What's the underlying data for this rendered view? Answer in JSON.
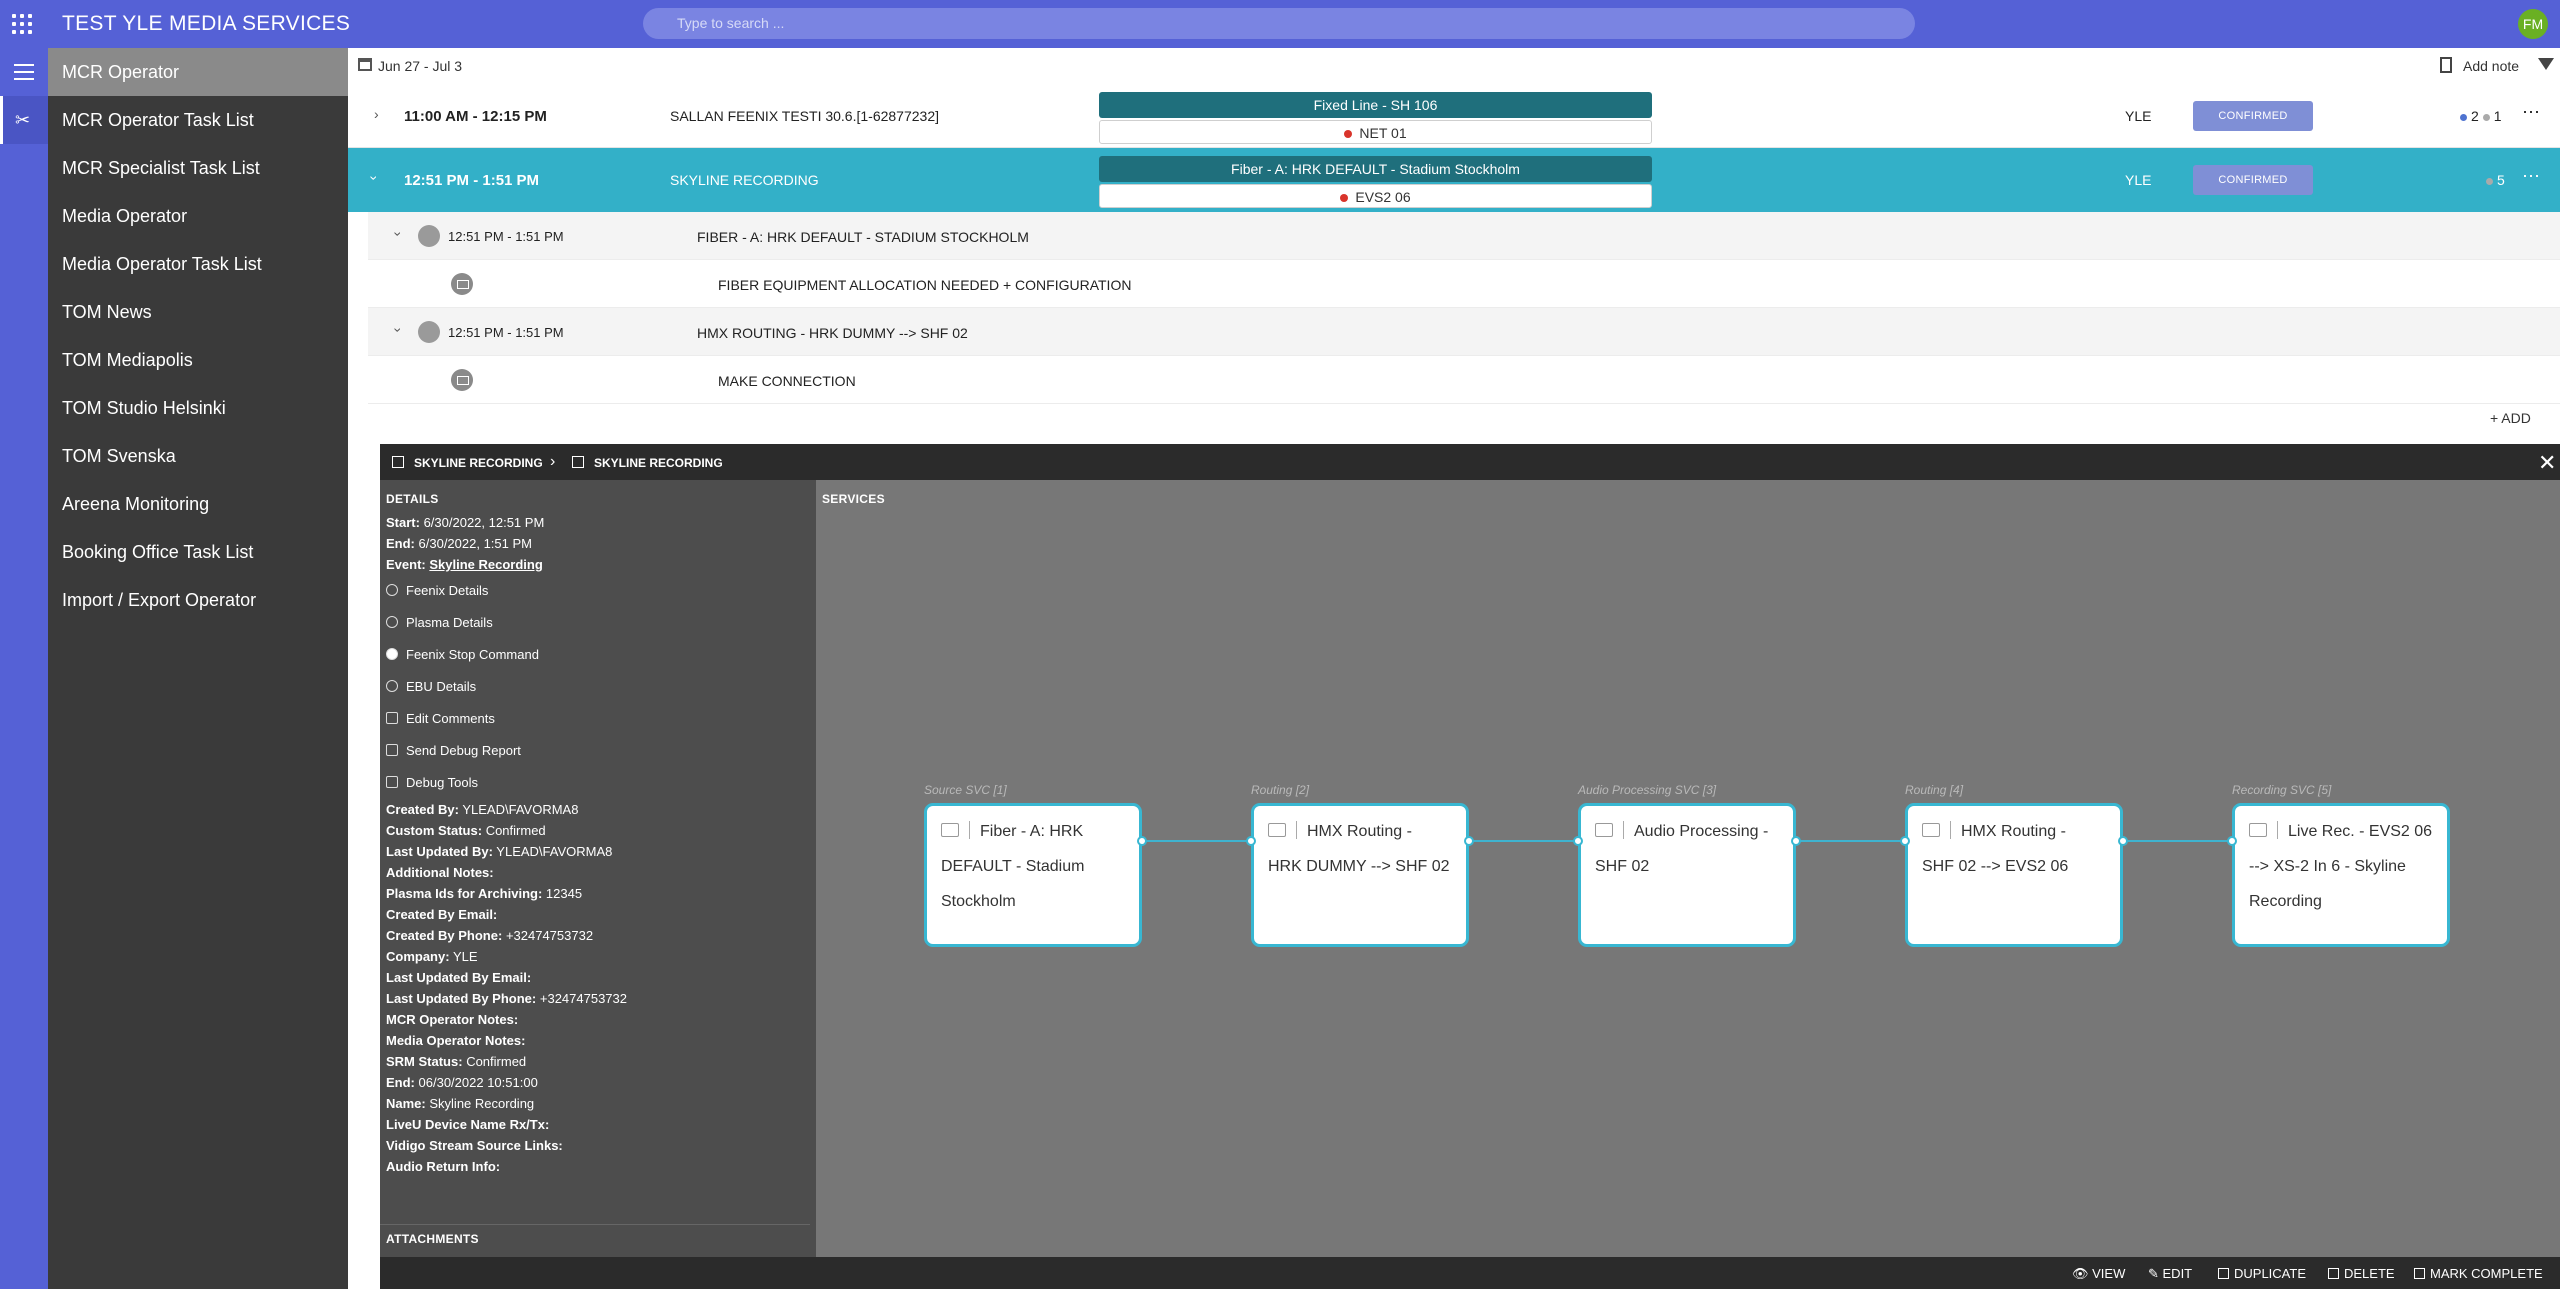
{
  "app": {
    "title": "TEST YLE MEDIA SERVICES",
    "avatar_initials": "FM"
  },
  "search": {
    "placeholder": "Type to search ..."
  },
  "sidebar": {
    "items": [
      {
        "label": "MCR Operator",
        "active": true
      },
      {
        "label": "MCR Operator Task List"
      },
      {
        "label": "MCR Specialist Task List"
      },
      {
        "label": "Media Operator"
      },
      {
        "label": "Media Operator Task List"
      },
      {
        "label": "TOM News"
      },
      {
        "label": "TOM Mediapolis"
      },
      {
        "label": "TOM Studio Helsinki"
      },
      {
        "label": "TOM Svenska"
      },
      {
        "label": "Areena Monitoring"
      },
      {
        "label": "Booking Office Task List"
      },
      {
        "label": "Import / Export Operator"
      }
    ]
  },
  "toolbar": {
    "date_range": "Jun 27 - Jul 3",
    "add_note": "Add note"
  },
  "bookings": [
    {
      "time": "11:00 AM - 12:15 PM",
      "name": "SALLAN FEENIX TESTI 30.6.[1-62877232]",
      "service_top": "Fixed Line - SH 106",
      "service_bottom": "NET 01",
      "company": "YLE",
      "status": "CONFIRMED",
      "count_a": "2",
      "count_b": "1"
    },
    {
      "time": "12:51 PM - 1:51 PM",
      "name": "SKYLINE RECORDING",
      "service_top": "Fiber - A: HRK DEFAULT - Stadium Stockholm",
      "service_bottom": "EVS2 06",
      "company": "YLE",
      "status": "CONFIRMED",
      "count_a": "5"
    }
  ],
  "subrows": [
    {
      "time": "12:51 PM - 1:51 PM",
      "name": "FIBER - A: HRK DEFAULT - STADIUM STOCKHOLM"
    },
    {
      "task": "FIBER EQUIPMENT ALLOCATION NEEDED + CONFIGURATION"
    },
    {
      "time": "12:51 PM - 1:51 PM",
      "name": "HMX ROUTING - HRK DUMMY --> SHF 02"
    },
    {
      "task": "MAKE CONNECTION"
    }
  ],
  "add_label": "ADD",
  "panel": {
    "crumb1": "SKYLINE RECORDING",
    "crumb2": "SKYLINE RECORDING",
    "details_title": "DETAILS",
    "services_title": "SERVICES",
    "attachments_title": "ATTACHMENTS",
    "start_label": "Start:",
    "start_value": "6/30/2022, 12:51 PM",
    "end_label": "End:",
    "end_value": "6/30/2022, 1:51 PM",
    "event_label": "Event:",
    "event_value": "Skyline Recording",
    "actions": [
      "Feenix Details",
      "Plasma Details",
      "Feenix Stop Command",
      "EBU Details",
      "Edit Comments",
      "Send Debug Report",
      "Debug Tools"
    ],
    "fields": [
      {
        "label": "Created By:",
        "value": "YLEAD\\FAVORMA8"
      },
      {
        "label": "Custom Status:",
        "value": "Confirmed"
      },
      {
        "label": "Last Updated By:",
        "value": "YLEAD\\FAVORMA8"
      },
      {
        "label": "Additional Notes:",
        "value": ""
      },
      {
        "label": "Plasma Ids for Archiving:",
        "value": "12345"
      },
      {
        "label": "Created By Email:",
        "value": ""
      },
      {
        "label": "Created By Phone:",
        "value": "+32474753732"
      },
      {
        "label": "Company:",
        "value": "YLE"
      },
      {
        "label": "Last Updated By Email:",
        "value": ""
      },
      {
        "label": "Last Updated By Phone:",
        "value": "+32474753732"
      },
      {
        "label": "MCR Operator Notes:",
        "value": ""
      },
      {
        "label": "Media Operator Notes:",
        "value": ""
      },
      {
        "label": "SRM Status:",
        "value": "Confirmed"
      },
      {
        "label": "End:",
        "value": "06/30/2022 10:51:00"
      },
      {
        "label": "Name:",
        "value": "Skyline Recording"
      },
      {
        "label": "LiveU Device Name Rx/Tx:",
        "value": ""
      },
      {
        "label": "Vidigo Stream Source Links:",
        "value": ""
      },
      {
        "label": "Audio Return Info:",
        "value": ""
      }
    ],
    "services": [
      {
        "label": "Source SVC [1]",
        "line1": "Fiber - A: HRK",
        "line2": "DEFAULT - Stadium",
        "line3": "Stockholm",
        "icon": "fiber-icon"
      },
      {
        "label": "Routing [2]",
        "line1": "HMX Routing -",
        "line2": "HRK DUMMY --> SHF 02",
        "line3": "",
        "icon": "grid-icon"
      },
      {
        "label": "Audio Processing SVC [3]",
        "line1": "Audio Processing -",
        "line2": "SHF 02",
        "line3": "",
        "icon": "speaker-icon"
      },
      {
        "label": "Routing [4]",
        "line1": "HMX Routing -",
        "line2": "SHF 02 --> EVS2 06",
        "line3": "",
        "icon": "grid-icon"
      },
      {
        "label": "Recording SVC [5]",
        "line1": "Live Rec. - EVS2 06",
        "line2": "--> XS-2 In 6 - Skyline",
        "line3": "Recording",
        "icon": "download-icon"
      }
    ],
    "footer": {
      "view": "VIEW",
      "edit": "EDIT",
      "duplicate": "DUPLICATE",
      "delete": "DELETE",
      "mark_complete": "MARK COMPLETE"
    }
  },
  "colors": {
    "brand": "#5561d6",
    "selected_row": "#33b0c8",
    "status_badge": "#7f8fd6",
    "connector": "#3fb3cf"
  }
}
